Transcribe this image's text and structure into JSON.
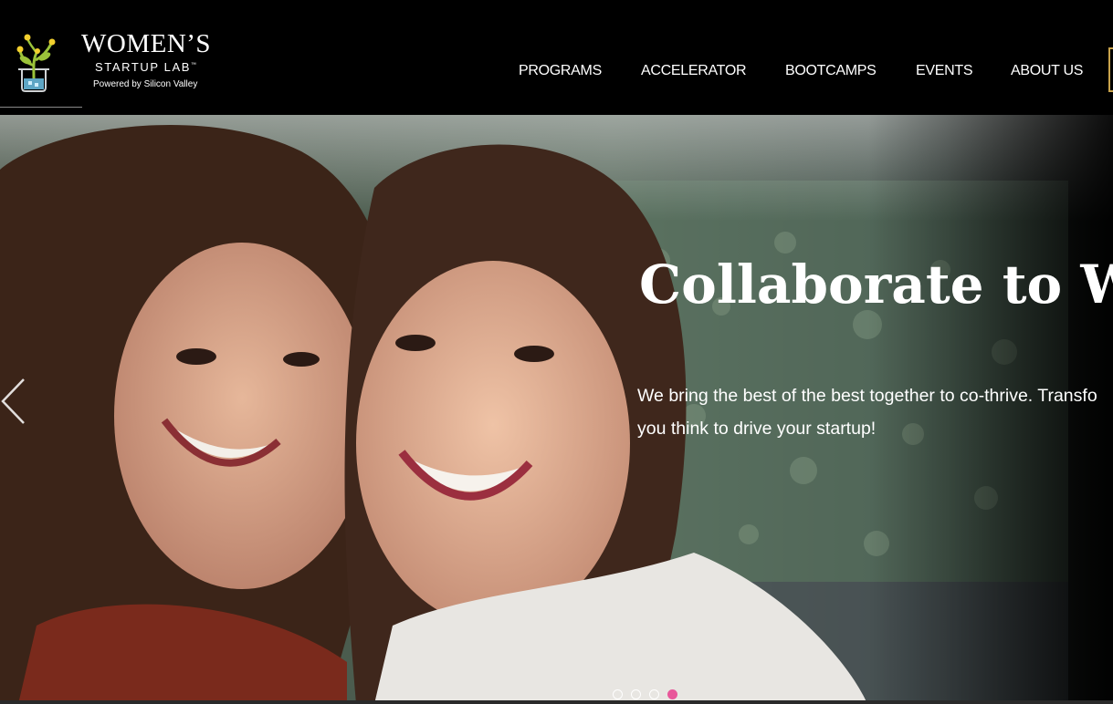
{
  "brand": {
    "name_line1": "WOMEN’S",
    "name_line2": "STARTUP LAB",
    "trademark": "™",
    "tagline": "Powered by Silicon Valley"
  },
  "nav": {
    "items": [
      {
        "label": "PROGRAMS"
      },
      {
        "label": "ACCELERATOR"
      },
      {
        "label": "BOOTCAMPS"
      },
      {
        "label": "EVENTS"
      },
      {
        "label": "ABOUT US"
      }
    ]
  },
  "hero": {
    "title": "Collaborate to Win",
    "body_line1": "We bring the best of the best together to co-thrive. Transfo",
    "body_line2": "you think to drive your startup!",
    "slides": {
      "count": 4,
      "active": 4
    }
  },
  "colors": {
    "header_bg": "#000000",
    "nav_text": "#ffffff",
    "active_dot": "#e8579a",
    "logo_plant": "#9bc33a",
    "logo_flower": "#f2cf2e",
    "logo_jar": "#6ec3e8"
  }
}
